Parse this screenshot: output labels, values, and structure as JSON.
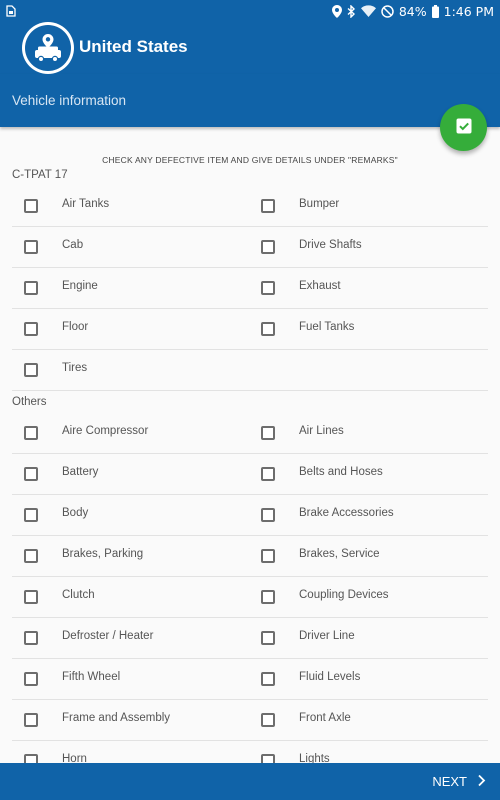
{
  "status_bar": {
    "notification_icon": "sim-card-icon",
    "icons": [
      "location-pin-icon",
      "bluetooth-icon",
      "wifi-icon",
      "do-not-disturb-icon"
    ],
    "battery": "84%",
    "time": "1:46 PM"
  },
  "app_bar": {
    "logo_icon": "truck-location-icon",
    "title": "United States"
  },
  "sub_bar": {
    "title": "Vehicle information"
  },
  "fab": {
    "icon": "checkbox-check-icon",
    "color": "#35ad3a"
  },
  "instruction": "CHECK ANY DEFECTIVE ITEM AND GIVE DETAILS UNDER \"REMARKS\"",
  "sections": [
    {
      "label": "C-TPAT 17",
      "items": [
        {
          "label": "Air Tanks",
          "checked": false
        },
        {
          "label": "Bumper",
          "checked": false
        },
        {
          "label": "Cab",
          "checked": false
        },
        {
          "label": "Drive Shafts",
          "checked": false
        },
        {
          "label": "Engine",
          "checked": false
        },
        {
          "label": "Exhaust",
          "checked": false
        },
        {
          "label": "Floor",
          "checked": false
        },
        {
          "label": "Fuel Tanks",
          "checked": false
        },
        {
          "label": "Tires",
          "checked": false
        }
      ]
    },
    {
      "label": "Others",
      "items": [
        {
          "label": "Aire Compressor",
          "checked": false
        },
        {
          "label": "Air Lines",
          "checked": false
        },
        {
          "label": "Battery",
          "checked": false
        },
        {
          "label": "Belts and Hoses",
          "checked": false
        },
        {
          "label": "Body",
          "checked": false
        },
        {
          "label": "Brake Accessories",
          "checked": false
        },
        {
          "label": "Brakes, Parking",
          "checked": false
        },
        {
          "label": "Brakes, Service",
          "checked": false
        },
        {
          "label": "Clutch",
          "checked": false
        },
        {
          "label": "Coupling Devices",
          "checked": false
        },
        {
          "label": "Defroster / Heater",
          "checked": false
        },
        {
          "label": "Driver Line",
          "checked": false
        },
        {
          "label": "Fifth Wheel",
          "checked": false
        },
        {
          "label": "Fluid Levels",
          "checked": false
        },
        {
          "label": "Frame and Assembly",
          "checked": false
        },
        {
          "label": "Front Axle",
          "checked": false
        },
        {
          "label": "Horn",
          "checked": false
        },
        {
          "label": "Lights",
          "checked": false
        }
      ]
    }
  ],
  "bottom_bar": {
    "next_label": "NEXT",
    "next_icon": "chevron-right-icon"
  },
  "colors": {
    "primary": "#1063a8",
    "accent": "#35ad3a",
    "divider": "#e2e2e2"
  }
}
